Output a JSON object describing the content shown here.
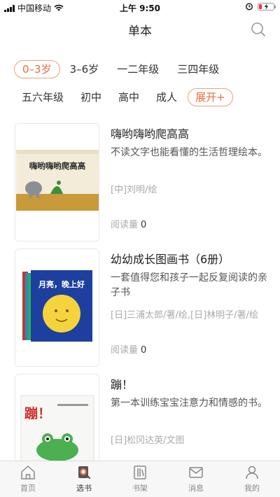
{
  "status_bar": {
    "carrier": "中国移动",
    "time": "上午 9:50"
  },
  "nav": {
    "title": "单本"
  },
  "filters": {
    "row1": [
      "0–3岁",
      "3–6岁",
      "一二年级",
      "三四年级"
    ],
    "row2": [
      "五六年级",
      "初中",
      "高中",
      "成人"
    ],
    "expand_label": "展开+",
    "selected": "0–3岁"
  },
  "books": [
    {
      "title": "嗨哟嗨哟爬高高",
      "description": "不读文字也能看懂的生活哲理绘本。",
      "author": "[中]刘明/绘",
      "reads_label": "阅读量",
      "reads": "0",
      "cover_text": "嗨哟嗨哟爬高高"
    },
    {
      "title": "幼幼成长图画书（6册）",
      "description": "一套值得您和孩子一起反复阅读的亲子书",
      "author": "[日]三浦太郎/著/绘,[日]林明子/著/绘",
      "reads_label": "阅读量",
      "reads": "0",
      "cover_text": "月亮，晚上好"
    },
    {
      "title": "蹦！",
      "description": "第一本训练宝宝注意力和情感的书。",
      "author": "[日]松冈达英/文图",
      "cover_text": "蹦！"
    }
  ],
  "tabs": [
    {
      "label": "首页",
      "icon": "home-icon"
    },
    {
      "label": "选书",
      "icon": "book-search-icon"
    },
    {
      "label": "书架",
      "icon": "bookshelf-icon"
    },
    {
      "label": "消息",
      "icon": "mail-icon"
    },
    {
      "label": "我的",
      "icon": "profile-icon"
    }
  ],
  "active_tab": "选书",
  "colors": {
    "accent": "#e46f3c",
    "chip_border": "#e9a27d"
  }
}
